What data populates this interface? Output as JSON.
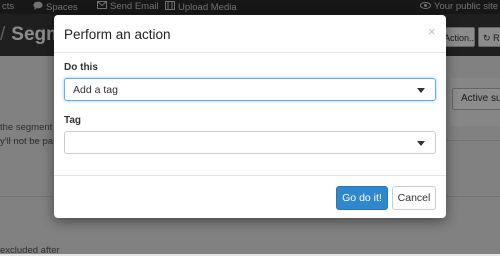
{
  "topbar": {
    "items": [
      {
        "label": "cts",
        "icon": "caret-icon"
      },
      {
        "label": "Spaces",
        "icon": "chat-bubble-icon"
      },
      {
        "label": "Send Email",
        "icon": "envelope-icon"
      },
      {
        "label": "Upload Media",
        "icon": "film-icon"
      },
      {
        "label": "Your public site",
        "icon": "eye-icon"
      }
    ]
  },
  "header": {
    "breadcrumb_sep": "/",
    "title_fragment": "Segme",
    "action_button": "Action...",
    "refresh_button": "R"
  },
  "background": {
    "active_button": "Active su",
    "text_1": "the segment",
    "text_2": "y'll not be pa",
    "text_3": "excluded after"
  },
  "modal": {
    "title": "Perform an action",
    "close": "×",
    "do_this_label": "Do this",
    "do_this_value": "Add a tag",
    "tag_label": "Tag",
    "tag_value": "",
    "submit_label": "Go do it!",
    "cancel_label": "Cancel"
  },
  "colors": {
    "primary": "#2f87cd",
    "focus": "#66afe9",
    "topbar": "#2b2b2b"
  }
}
